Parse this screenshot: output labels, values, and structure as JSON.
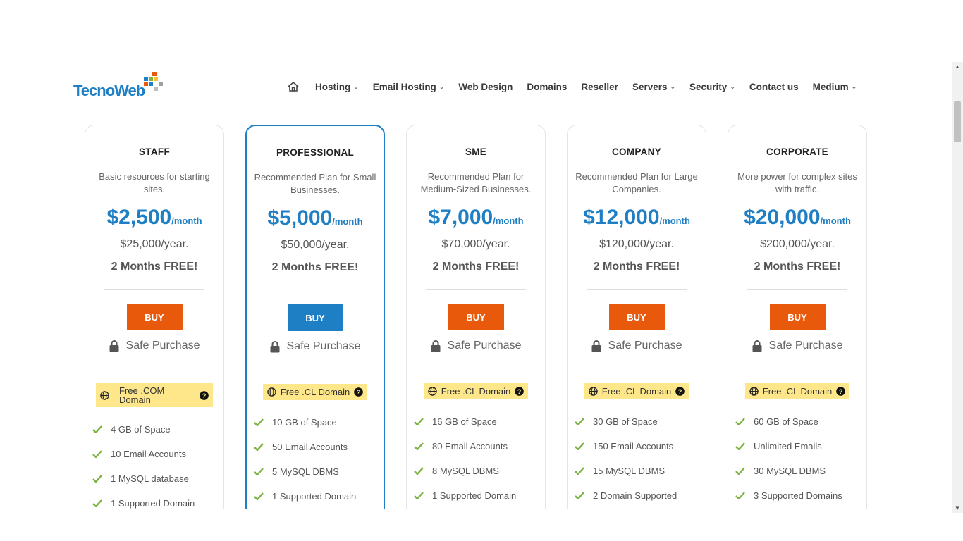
{
  "header": {
    "logo": {
      "part1": "Tecno",
      "part2": "Web"
    },
    "nav": [
      {
        "label": "Hosting",
        "has_menu": true
      },
      {
        "label": "Email Hosting",
        "has_menu": true
      },
      {
        "label": "Web Design",
        "has_menu": false
      },
      {
        "label": "Domains",
        "has_menu": false
      },
      {
        "label": "Reseller",
        "has_menu": false
      },
      {
        "label": "Servers",
        "has_menu": true
      },
      {
        "label": "Security",
        "has_menu": true
      },
      {
        "label": "Contact us",
        "has_menu": false
      },
      {
        "label": "Medium",
        "has_menu": true
      }
    ]
  },
  "colors": {
    "accent": "#1f7fc4",
    "buy": "#e8590c",
    "domain_bg": "#fde78a",
    "check": "#7cb342"
  },
  "plans": [
    {
      "name": "STAFF",
      "description": "Basic resources for starting sites.",
      "price": "$2,500",
      "period": "/month",
      "yearly": "$25,000/year.",
      "promo": "2 Months FREE!",
      "buy_label": "BUY",
      "safe_label": "Safe Purchase",
      "domain": "Free .COM Domain",
      "features": [
        "4 GB of Space",
        "10 Email Accounts",
        "1 MySQL database",
        "1 Supported Domain"
      ]
    },
    {
      "name": "PROFESSIONAL",
      "description": "Recommended Plan for Small Businesses.",
      "price": "$5,000",
      "period": "/month",
      "yearly": "$50,000/year.",
      "promo": "2 Months FREE!",
      "buy_label": "BUY",
      "safe_label": "Safe Purchase",
      "domain": "Free .CL Domain",
      "features": [
        "10 GB of Space",
        "50 Email Accounts",
        "5 MySQL DBMS",
        "1 Supported Domain"
      ]
    },
    {
      "name": "SME",
      "description": "Recommended Plan for Medium-Sized Businesses.",
      "price": "$7,000",
      "period": "/month",
      "yearly": "$70,000/year.",
      "promo": "2 Months FREE!",
      "buy_label": "BUY",
      "safe_label": "Safe Purchase",
      "domain": "Free .CL Domain",
      "features": [
        "16 GB of Space",
        "80 Email Accounts",
        "8 MySQL DBMS",
        "1 Supported Domain"
      ]
    },
    {
      "name": "COMPANY",
      "description": "Recommended Plan for Large Companies.",
      "price": "$12,000",
      "period": "/month",
      "yearly": "$120,000/year.",
      "promo": "2 Months FREE!",
      "buy_label": "BUY",
      "safe_label": "Safe Purchase",
      "domain": "Free .CL Domain",
      "features": [
        "30 GB of Space",
        "150 Email Accounts",
        "15 MySQL DBMS",
        "2 Domain Supported"
      ]
    },
    {
      "name": "CORPORATE",
      "description": "More power for complex sites with traffic.",
      "price": "$20,000",
      "period": "/month",
      "yearly": "$200,000/year.",
      "promo": "2 Months FREE!",
      "buy_label": "BUY",
      "safe_label": "Safe Purchase",
      "domain": "Free .CL Domain",
      "features": [
        "60 GB of Space",
        "Unlimited Emails",
        "30 MySQL DBMS",
        "3 Supported Domains"
      ]
    }
  ]
}
